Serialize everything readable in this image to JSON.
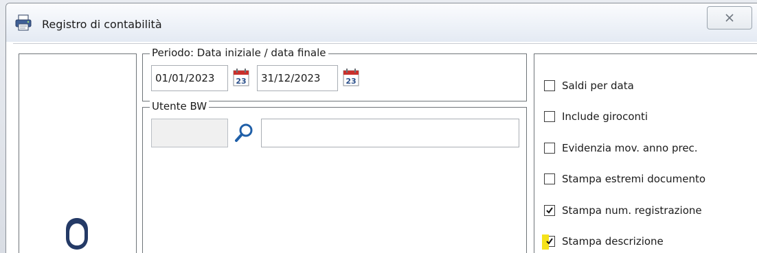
{
  "window": {
    "title": "Registro di contabilità",
    "close_glyph": "✕"
  },
  "periodo": {
    "legend": "Periodo: Data iniziale / data finale",
    "start_date": "01/01/2023",
    "end_date": "31/12/2023",
    "calendar_day": "23"
  },
  "utente": {
    "legend": "Utente BW",
    "code_value": "",
    "name_value": ""
  },
  "options": [
    {
      "label": "Saldi per data",
      "checked": false
    },
    {
      "label": "Include giroconti",
      "checked": false
    },
    {
      "label": "Evidenzia mov. anno prec.",
      "checked": false
    },
    {
      "label": "Stampa estremi documento",
      "checked": false
    },
    {
      "label": "Stampa num. registrazione",
      "checked": true
    },
    {
      "label": "Stampa descrizione",
      "checked": true
    }
  ],
  "colors": {
    "accent_focus": "#f5e21a",
    "calendar_red": "#c9302c",
    "search_blue": "#1f5fa8"
  },
  "icons": {
    "title": "printer-icon",
    "calendar": "calendar-icon",
    "search": "search-icon",
    "user": "user-avatar-icon",
    "close": "close-icon"
  }
}
